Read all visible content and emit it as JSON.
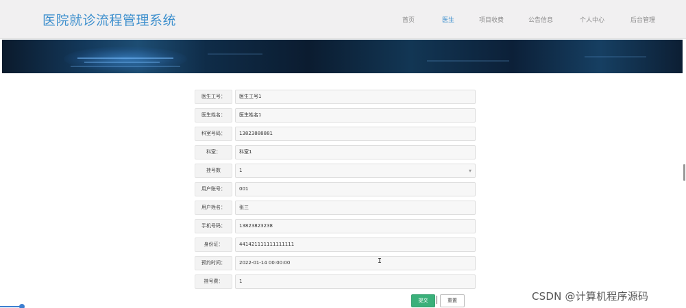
{
  "header": {
    "site_title": "医院就诊流程管理系统",
    "nav": [
      {
        "label": "首页",
        "active": false
      },
      {
        "label": "医生",
        "active": true
      },
      {
        "label": "项目收费",
        "active": false
      },
      {
        "label": "公告信息",
        "active": false
      },
      {
        "label": "个人中心",
        "active": false
      },
      {
        "label": "后台管理",
        "active": false
      }
    ]
  },
  "form": {
    "fields": [
      {
        "label": "医生工号：",
        "value": "医生工号1"
      },
      {
        "label": "医生姓名：",
        "value": "医生姓名1"
      },
      {
        "label": "科室号码：",
        "value": "13823888881"
      },
      {
        "label": "科室：",
        "value": "科室1"
      },
      {
        "label": "挂号数",
        "value": "1",
        "type": "select"
      },
      {
        "label": "用户账号：",
        "value": "001"
      },
      {
        "label": "用户姓名：",
        "value": "张三"
      },
      {
        "label": "手机号码：",
        "value": "13823823238"
      },
      {
        "label": "身份证：",
        "value": "441421111111111111"
      },
      {
        "label": "预约时间：",
        "value": "2022-01-14 00:00:00"
      },
      {
        "label": "挂号费：",
        "value": "1"
      }
    ],
    "submit_label": "提交",
    "reset_label": "重置"
  },
  "cursor_glyph": "I",
  "watermark": "CSDN @计算机程序源码",
  "colors": {
    "accent": "#3d8fcd",
    "submit": "#3ab07a",
    "header_bg": "#f1f0f1"
  }
}
